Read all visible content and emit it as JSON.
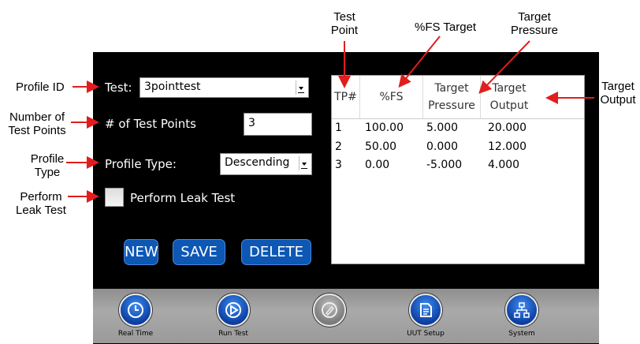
{
  "form": {
    "test_label": "Test:",
    "test_value": "3pointtest",
    "points_label": "# of Test Points",
    "points_value": "3",
    "profile_type_label": "Profile Type:",
    "profile_type_value": "Descending",
    "leak_label": "Perform Leak Test",
    "leak_checked": false
  },
  "buttons": {
    "new": "NEW",
    "save": "SAVE",
    "delete": "DELETE"
  },
  "table": {
    "headers": [
      {
        "line1": "TP#",
        "line2": ""
      },
      {
        "line1": "%FS",
        "line2": ""
      },
      {
        "line1": "Target",
        "line2": "Pressure"
      },
      {
        "line1": "Target",
        "line2": "Output"
      }
    ],
    "rows": [
      [
        "1",
        "100.00",
        "5.000",
        "20.000"
      ],
      [
        "2",
        "50.00",
        "0.000",
        "12.000"
      ],
      [
        "3",
        "0.00",
        "-5.000",
        "4.000"
      ]
    ]
  },
  "nav": [
    {
      "label": "Real Time",
      "icon": "clock-icon",
      "disabled": false
    },
    {
      "label": "Run Test",
      "icon": "play-icon",
      "disabled": false
    },
    {
      "label": "",
      "icon": "edit-icon",
      "disabled": true
    },
    {
      "label": "UUT Setup",
      "icon": "document-icon",
      "disabled": false
    },
    {
      "label": "System",
      "icon": "network-icon",
      "disabled": false
    }
  ],
  "annotations": {
    "profile_id": "Profile ID",
    "number_of_points": [
      "Number of",
      "Test Points"
    ],
    "profile_type": [
      "Profile",
      "Type"
    ],
    "perform_leak": [
      "Perform",
      "Leak Test"
    ],
    "test_point": [
      "Test",
      "Point"
    ],
    "fs_target": "%FS Target",
    "target_pressure": [
      "Target",
      "Pressure"
    ],
    "target_output": [
      "Target",
      "Output"
    ]
  },
  "colors": {
    "accent": "#0d57b5",
    "arrow": "#e11d1d",
    "screen": "#000000",
    "navbar": "#9a9a9a"
  }
}
